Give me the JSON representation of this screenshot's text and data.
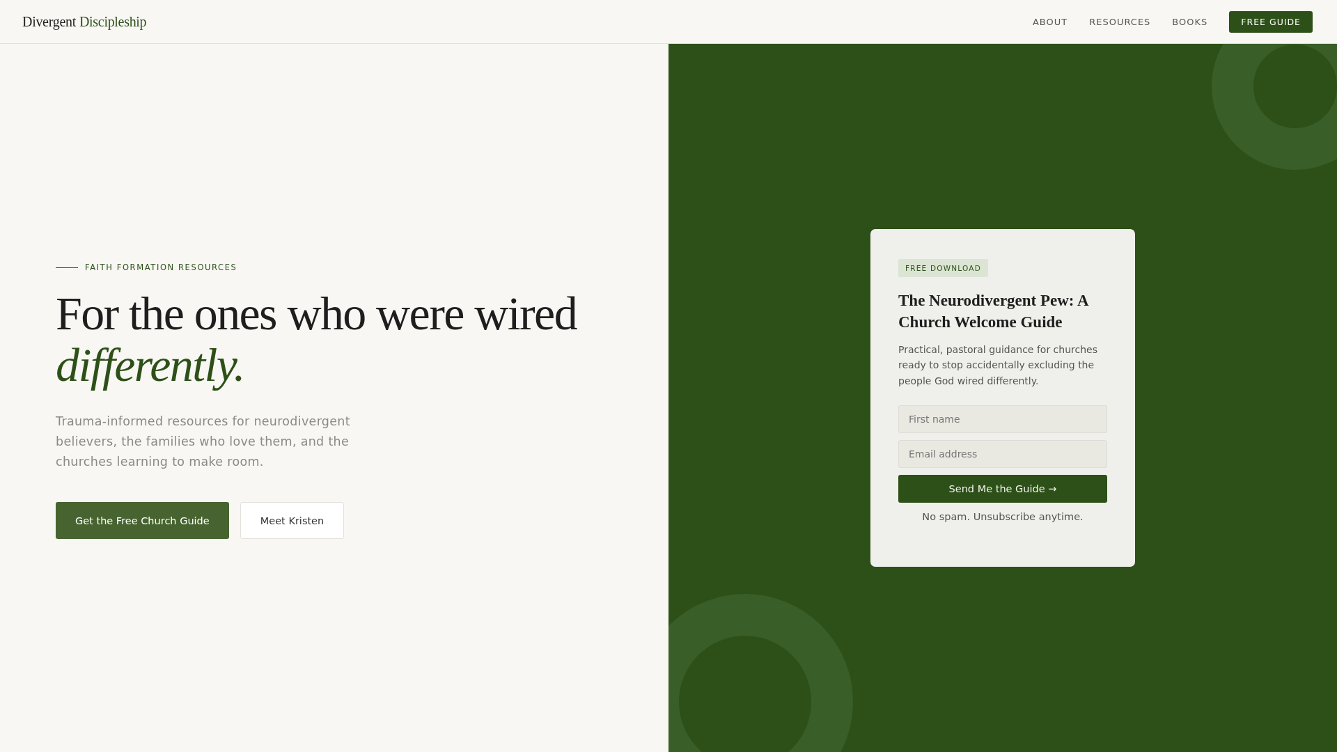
{
  "header": {
    "logo": {
      "first": "Divergent",
      "second": "Discipleship"
    },
    "nav": [
      {
        "label": "ABOUT",
        "kind": "link"
      },
      {
        "label": "RESOURCES",
        "kind": "link"
      },
      {
        "label": "BOOKS",
        "kind": "link"
      },
      {
        "label": "FREE GUIDE",
        "kind": "button"
      }
    ]
  },
  "hero": {
    "eyebrow": "FAITH FORMATION RESOURCES",
    "headline": "For the ones who were wired *differently.*",
    "subtitle": "Trauma-informed resources for neurodivergent believers, the families who love them, and the churches learning to make room.",
    "buttons": [
      {
        "label": "Get the Free Church Guide",
        "kind": "primary"
      },
      {
        "label": "Meet Kristen",
        "kind": "secondary"
      }
    ]
  },
  "signup_card": {
    "badge": "FREE DOWNLOAD",
    "title": "The Neurodivergent Pew: A Church Welcome Guide",
    "description": "Practical, pastoral guidance for churches ready to stop accidentally excluding the people God wired differently.",
    "fields": [
      {
        "placeholder": "First name"
      },
      {
        "placeholder": "Email address"
      }
    ],
    "submit": "Send Me the Guide →",
    "note": "No spam. Unsubscribe anytime."
  }
}
